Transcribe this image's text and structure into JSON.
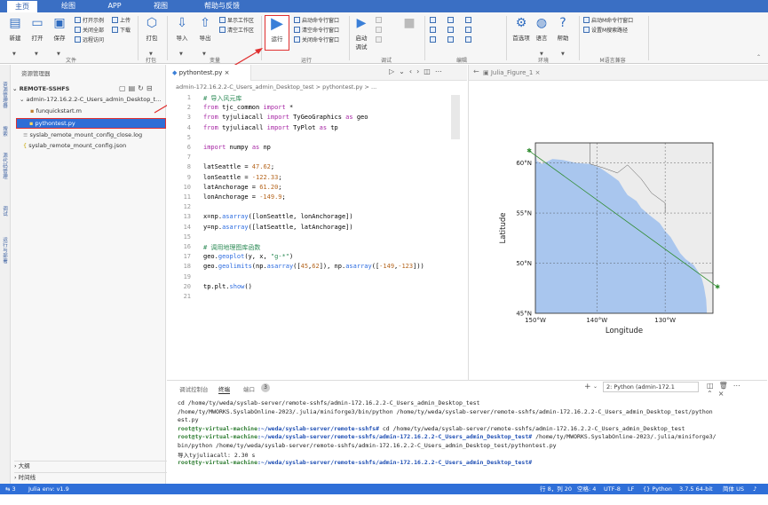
{
  "menubar": {
    "tabs": [
      "主页",
      "绘图",
      "APP",
      "视图",
      "帮助与反馈"
    ]
  },
  "ribbon": {
    "buttons": {
      "new": "新建",
      "open": "打开",
      "save": "保存",
      "pack": "打包",
      "import": "导入",
      "export": "导出",
      "run": "运行",
      "debug": "启动\n调试",
      "env": "首选项",
      "lang": "语言",
      "help": "帮助"
    },
    "small": {
      "open_example": "打开示例",
      "close_all": "关闭全部",
      "remote_access": "远程访问",
      "upload": "上传",
      "download": "下载",
      "show_workspace": "显示工作区",
      "clear_workspace": "清空工作区",
      "start_cmd": "启动命令行窗口",
      "clear_cmd": "清空命令行窗口",
      "close_cmd": "关闭命令行窗口",
      "start_mrun": "启动M命令行窗口",
      "set_mpath": "设置M搜索路径"
    },
    "groups": [
      "文件",
      "打包",
      "变量",
      "运行",
      "调试",
      "编辑",
      "环境",
      "M语言兼容"
    ]
  },
  "sidebar": {
    "vertical_labels": [
      "资源管理器",
      "搜索",
      "源代码管理",
      "调试",
      "运行与部署"
    ]
  },
  "explorer": {
    "title": "资源管理器",
    "root": "REMOTE-SSHFS",
    "items": [
      "admin-172.16.2.2-C_Users_admin_Desktop_t...",
      "funquickstart.m",
      "pythontest.py",
      "syslab_remote_mount_config_close.log",
      "syslab_remote_mount_config.json"
    ],
    "outline": "大纲",
    "timeline": "时间线"
  },
  "editor": {
    "tab": "pythontest.py",
    "breadcrumb": "admin-172.16.2.2-C_Users_admin_Desktop_test  >  pythontest.py  >  ...",
    "lines": [
      "# 导入风元库",
      "from tjc_common import *",
      "from tyjuliacall import TyGeoGraphics as geo",
      "from tyjuliacall import TyPlot as tp",
      "",
      "import numpy as np",
      "",
      "latSeattle = 47.62;",
      "lonSeattle = -122.33;",
      "latAnchorage = 61.20;",
      "lonAnchorage = -149.9;",
      "",
      "x=np.asarray([lonSeattle, lonAnchorage])",
      "y=np.asarray([latSeattle, latAnchorage])",
      "",
      "# 调用地理图库函数",
      "geo.geoplot(y, x, \"g-*\")",
      "geo.geolimits(np.asarray([45,62]), np.asarray([-149,-123]))",
      "",
      "tp.plt.show()",
      ""
    ]
  },
  "figure": {
    "tab": "Julia_Figure_1",
    "ylabel": "Latitude",
    "xlabel": "Longitude",
    "yticks": [
      "60°N",
      "55°N",
      "50°N",
      "45°N"
    ],
    "xticks": [
      "150°W",
      "140°W",
      "130°W"
    ]
  },
  "chart_data": {
    "type": "line",
    "series": [
      {
        "x": [
          -149.9,
          -122.33
        ],
        "y": [
          61.2,
          47.62
        ]
      }
    ],
    "xlabel": "Longitude",
    "ylabel": "Latitude",
    "xlim": [
      -149,
      -123
    ],
    "ylim": [
      45,
      62
    ],
    "color": "#2e8b2e"
  },
  "terminal": {
    "tabs": [
      "调试控制台",
      "终端",
      "端口"
    ],
    "port_count": "3",
    "shell": "2: Python (admin-172.1",
    "lines": [
      "cd /home/ty/weda/syslab-server/remote-sshfs/admin-172.16.2.2-C_Users_admin_Desktop_test",
      "/home/ty/MWORKS.SyslabOnline-2023/.julia/miniforge3/bin/python /home/ty/weda/syslab-server/remote-sshfs/admin-172.16.2.2-C_Users_admin_Desktop_test/python",
      "est.py",
      "root@ty-virtual-machine:~/weda/syslab-server/remote-sshfs# cd /home/ty/weda/syslab-server/remote-sshfs/admin-172.16.2.2-C_Users_admin_Desktop_test",
      "root@ty-virtual-machine:~/weda/syslab-server/remote-sshfs/admin-172.16.2.2-C_Users_admin_Desktop_test# /home/ty/MWORKS.SyslabOnline-2023/.julia/miniforge3/",
      "bin/python /home/ty/weda/syslab-server/remote-sshfs/admin-172.16.2.2-C_Users_admin_Desktop_test/pythontest.py",
      "导入tyjuliacall: 2.30 s",
      "root@ty-virtual-machine:~/weda/syslab-server/remote-sshfs/admin-172.16.2.2-C_Users_admin_Desktop_test# "
    ]
  },
  "statusbar": {
    "left": "3",
    "julia": "Julia env: v1.9",
    "position": "行 8，列 20",
    "spaces": "空格: 4",
    "encoding": "UTF-8",
    "eol": "LF",
    "lang": "Python",
    "interp": "3.7.5 64-bit",
    "locale": "简体 US"
  },
  "colors": {
    "menubar": "#3a6fc4",
    "statusbar": "#2f6fd8",
    "accent": "#2f6cc0",
    "highlight_red": "#e03030"
  }
}
